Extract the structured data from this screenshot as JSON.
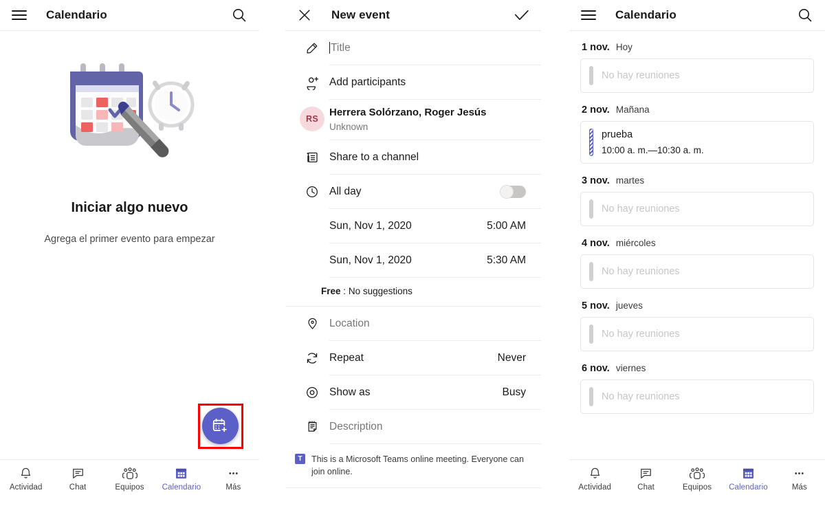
{
  "left_panel": {
    "appbar": {
      "menu_icon": "hamburger-icon",
      "title": "Calendario",
      "search_icon": "search-icon"
    },
    "empty_state": {
      "illustration": "calendar-pen-clock-illustration",
      "title": "Iniciar algo nuevo",
      "subtitle": "Agrega el primer evento para empezar"
    },
    "fab": {
      "icon": "calendar-add-icon",
      "highlighted": true,
      "highlight_color": "#ff0000",
      "color": "#5b5fc7"
    },
    "bottom_nav": [
      {
        "label": "Actividad",
        "icon": "bell-icon",
        "active": false
      },
      {
        "label": "Chat",
        "icon": "chat-icon",
        "active": false
      },
      {
        "label": "Equipos",
        "icon": "teams-icon",
        "active": false
      },
      {
        "label": "Calendario",
        "icon": "calendar-icon",
        "active": true
      },
      {
        "label": "Más",
        "icon": "more-icon",
        "active": false
      }
    ]
  },
  "mid_panel": {
    "appbar": {
      "close_icon": "close-icon",
      "title": "New event",
      "confirm_icon": "check-icon"
    },
    "title_field": {
      "icon": "pencil-icon",
      "value": "",
      "placeholder": "Title"
    },
    "participants": {
      "icon": "add-person-icon",
      "label": "Add participants"
    },
    "organizer": {
      "initials": "RS",
      "name": "Herrera Solórzano, Roger Jesús",
      "status": "Unknown"
    },
    "share_channel": {
      "icon": "channel-icon",
      "label": "Share to a channel"
    },
    "all_day": {
      "icon": "clock-icon",
      "label": "All day",
      "enabled": false
    },
    "start": {
      "date": "Sun, Nov 1, 2020",
      "time": "5:00 AM"
    },
    "end": {
      "date": "Sun, Nov 1, 2020",
      "time": "5:30 AM"
    },
    "availability": {
      "status": "Free",
      "separator": ":",
      "suggestions": "No suggestions"
    },
    "location": {
      "icon": "location-pin-icon",
      "placeholder": "Location"
    },
    "repeat": {
      "icon": "repeat-icon",
      "label": "Repeat",
      "value": "Never"
    },
    "show_as": {
      "icon": "eye-icon",
      "label": "Show as",
      "value": "Busy"
    },
    "description": {
      "icon": "notes-icon",
      "placeholder": "Description"
    },
    "online_note": {
      "icon": "teams-logo-icon",
      "badge_text": "T",
      "text": "This is a Microsoft Teams online meeting. Everyone can join online."
    }
  },
  "right_panel": {
    "appbar": {
      "menu_icon": "hamburger-icon",
      "title": "Calendario",
      "search_icon": "search-icon"
    },
    "empty_label": "No hay reuniones",
    "days": [
      {
        "date": "1 nov.",
        "weekday": "Hoy",
        "events": []
      },
      {
        "date": "2 nov.",
        "weekday": "Mañana",
        "events": [
          {
            "title": "prueba",
            "time": "10:00 a. m.—10:30 a. m."
          }
        ]
      },
      {
        "date": "3 nov.",
        "weekday": "martes",
        "events": []
      },
      {
        "date": "4 nov.",
        "weekday": "miércoles",
        "events": []
      },
      {
        "date": "5 nov.",
        "weekday": "jueves",
        "events": []
      },
      {
        "date": "6 nov.",
        "weekday": "viernes",
        "events": []
      }
    ],
    "fab": {
      "icon": "calendar-add-icon",
      "color": "#5b5fc7"
    },
    "bottom_nav": [
      {
        "label": "Actividad",
        "icon": "bell-icon",
        "active": false
      },
      {
        "label": "Chat",
        "icon": "chat-icon",
        "active": false
      },
      {
        "label": "Equipos",
        "icon": "teams-icon",
        "active": false
      },
      {
        "label": "Calendario",
        "icon": "calendar-icon",
        "active": true
      },
      {
        "label": "Más",
        "icon": "more-icon",
        "active": false
      }
    ]
  }
}
